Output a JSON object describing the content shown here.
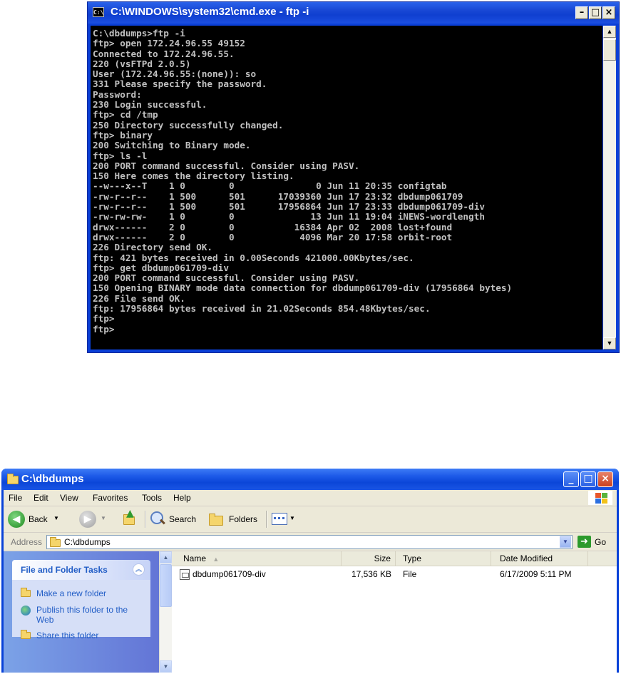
{
  "cmd": {
    "title": "C:\\WINDOWS\\system32\\cmd.exe - ftp -i",
    "lines": [
      "C:\\dbdumps>ftp -i",
      "ftp> open 172.24.96.55 49152",
      "Connected to 172.24.96.55.",
      "220 (vsFTPd 2.0.5)",
      "User (172.24.96.55:(none)): so",
      "331 Please specify the password.",
      "Password:",
      "230 Login successful.",
      "ftp> cd /tmp",
      "250 Directory successfully changed.",
      "ftp> binary",
      "200 Switching to Binary mode.",
      "ftp> ls -l",
      "200 PORT command successful. Consider using PASV.",
      "150 Here comes the directory listing.",
      "--w---x--T    1 0        0               0 Jun 11 20:35 configtab",
      "-rw-r--r--    1 500      501      17039360 Jun 17 23:32 dbdump061709",
      "-rw-r--r--    1 500      501      17956864 Jun 17 23:33 dbdump061709-div",
      "-rw-rw-rw-    1 0        0              13 Jun 11 19:04 iNEWS-wordlength",
      "drwx------    2 0        0           16384 Apr 02  2008 lost+found",
      "drwx------    2 0        0            4096 Mar 20 17:58 orbit-root",
      "226 Directory send OK.",
      "ftp: 421 bytes received in 0.00Seconds 421000.00Kbytes/sec.",
      "ftp> get dbdump061709-div",
      "200 PORT command successful. Consider using PASV.",
      "150 Opening BINARY mode data connection for dbdump061709-div (17956864 bytes)",
      "226 File send OK.",
      "ftp: 17956864 bytes received in 21.02Seconds 854.48Kbytes/sec.",
      "ftp>",
      "ftp>"
    ],
    "icon_text": "C:\\"
  },
  "explorer": {
    "title": "C:\\dbdumps",
    "menu": [
      "File",
      "Edit",
      "View",
      "Favorites",
      "Tools",
      "Help"
    ],
    "toolbar": {
      "back": "Back",
      "search": "Search",
      "folders": "Folders"
    },
    "address": {
      "label": "Address",
      "value": "C:\\dbdumps",
      "go": "Go"
    },
    "tasks": {
      "header": "File and Folder Tasks",
      "items": [
        "Make a new folder",
        "Publish this folder to the Web",
        "Share this folder"
      ]
    },
    "columns": [
      "Name",
      "Size",
      "Type",
      "Date Modified"
    ],
    "files": [
      {
        "name": "dbdump061709-div",
        "size": "17,536 KB",
        "type": "File",
        "modified": "6/17/2009 5:11 PM"
      }
    ]
  },
  "icons": {
    "cmd": "console-icon",
    "folder": "folder-icon",
    "back": "back-arrow-icon",
    "forward": "forward-arrow-icon",
    "up": "folder-up-icon",
    "search": "magnifier-icon",
    "views": "views-icon",
    "go": "go-arrow-icon"
  },
  "colors": {
    "xp_title_blue": "#0b46d8",
    "console_text": "#c0c0c0",
    "task_link": "#215dc6"
  }
}
